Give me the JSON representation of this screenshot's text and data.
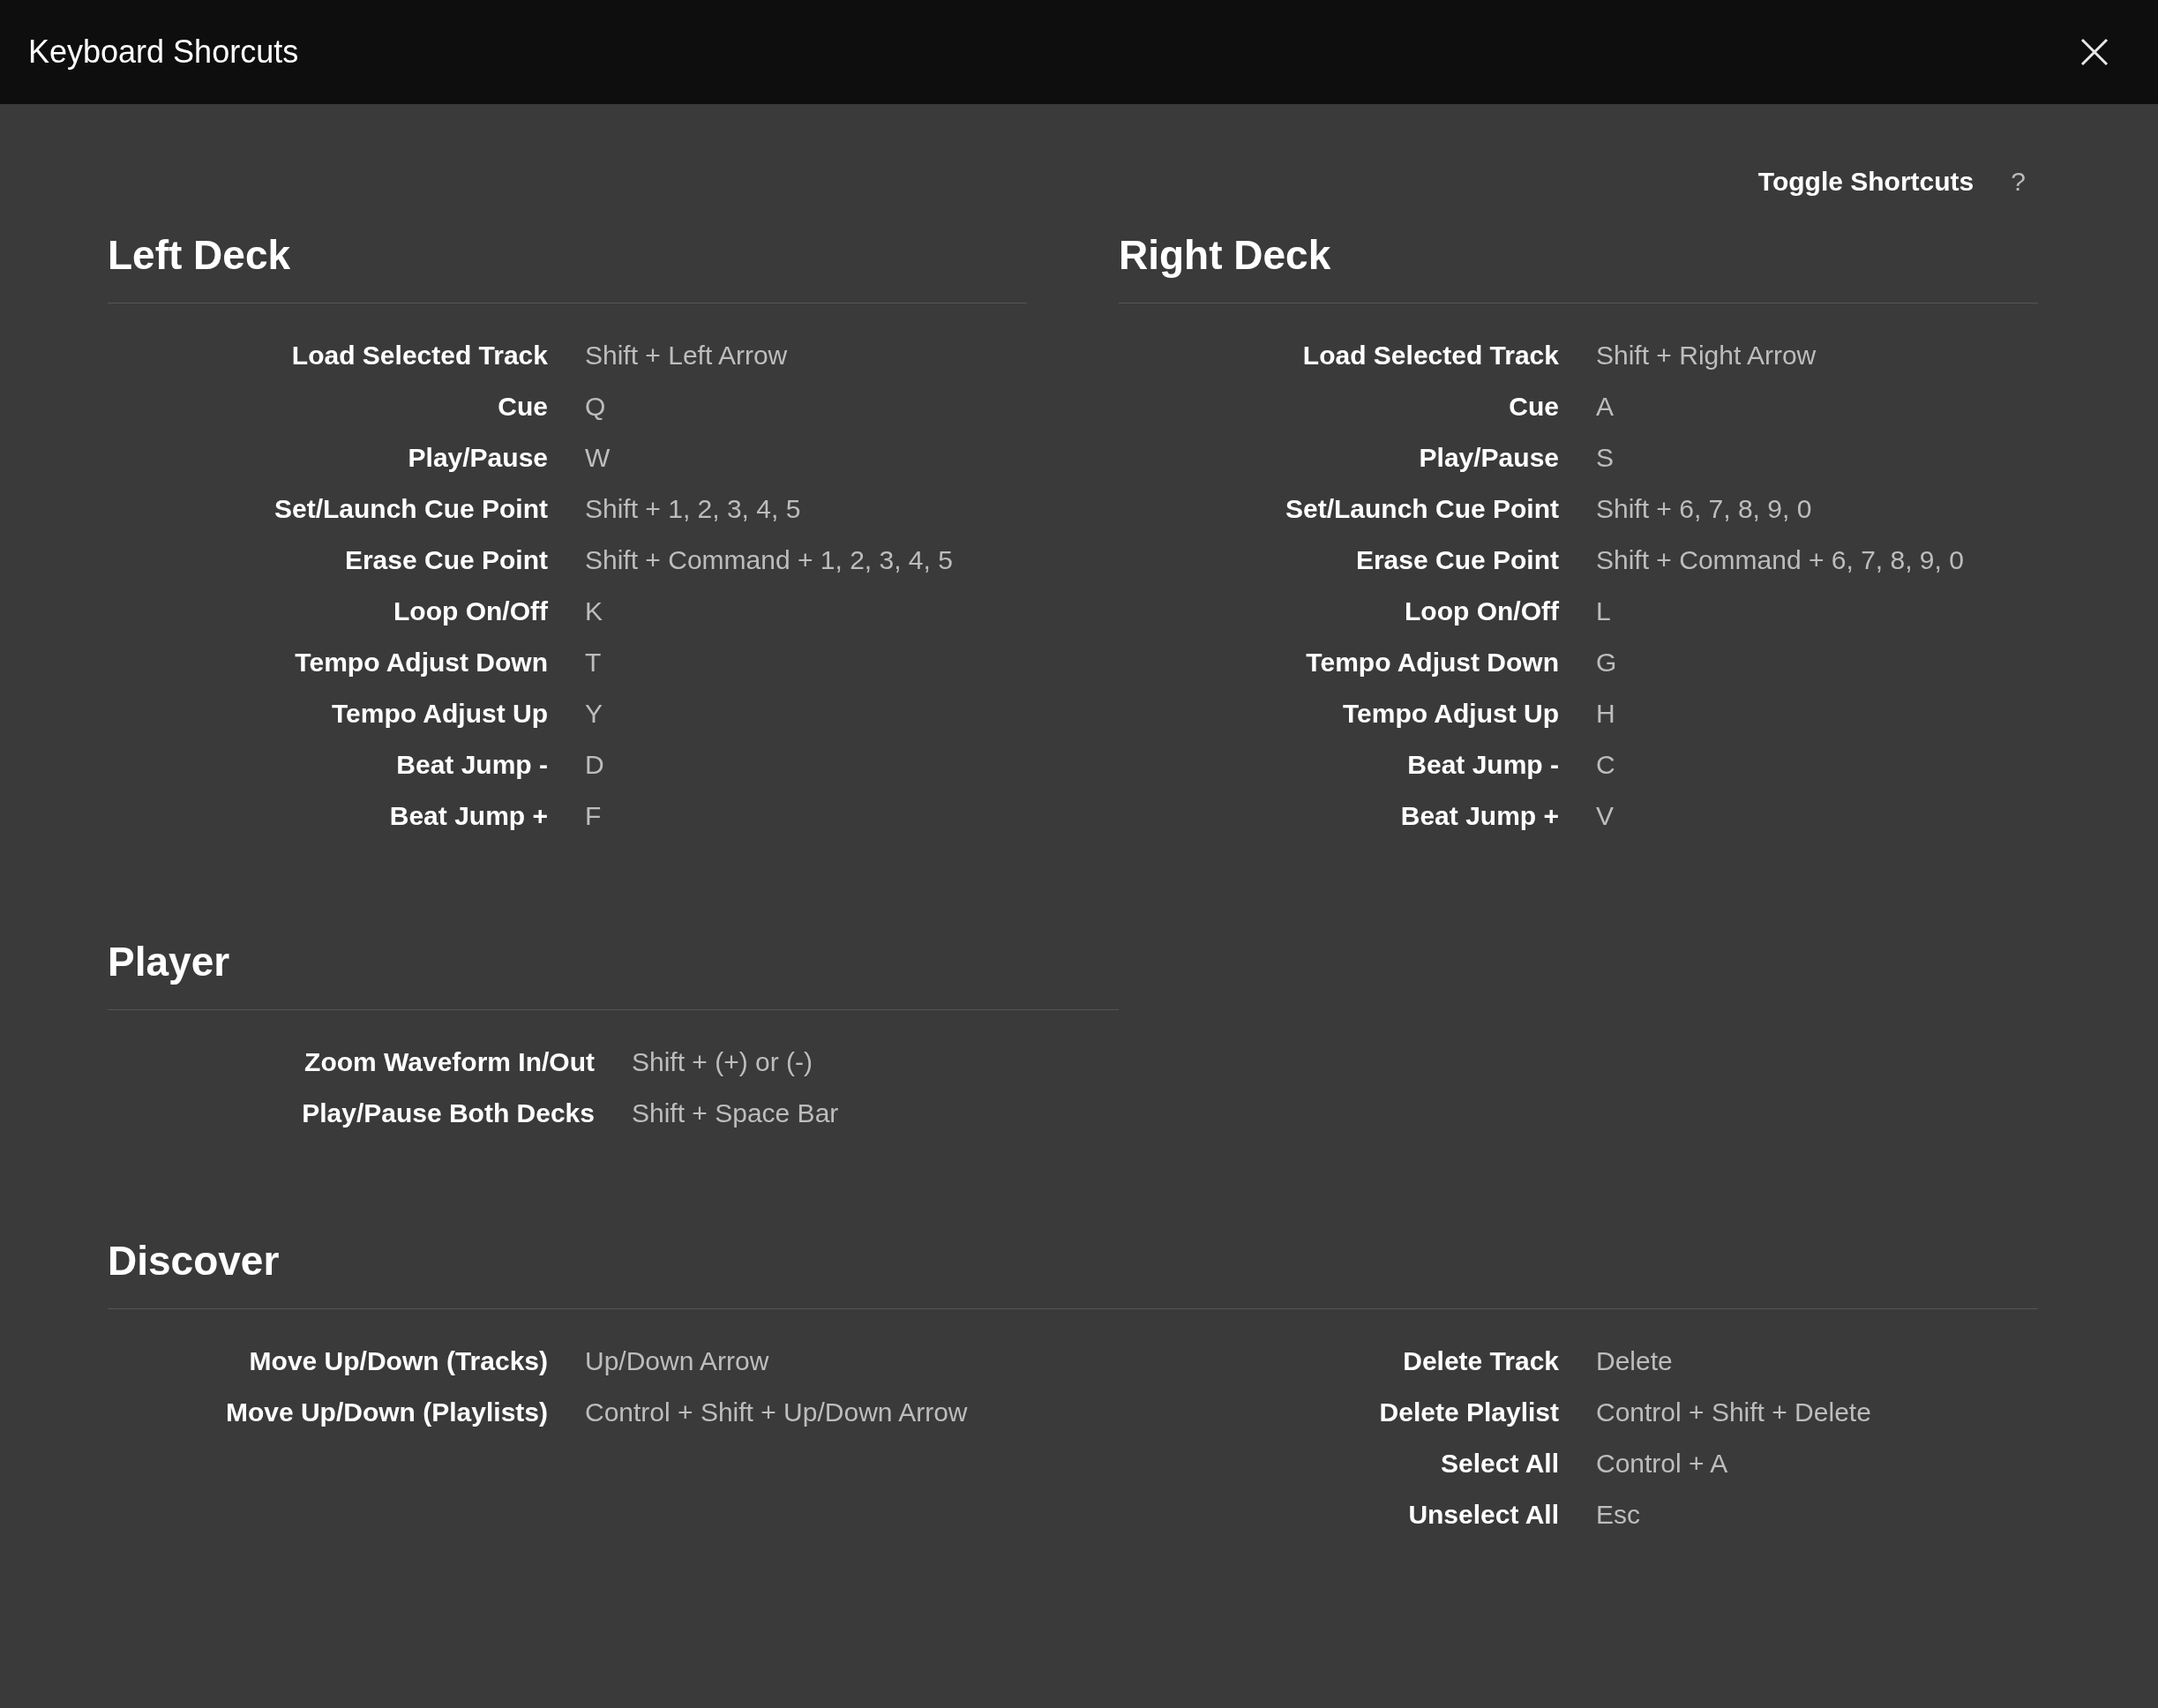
{
  "window": {
    "title": "Keyboard Shorcuts"
  },
  "toggle": {
    "label": "Toggle Shortcuts",
    "key": "?"
  },
  "decks": [
    {
      "heading": "Left Deck",
      "shortcuts": [
        {
          "action": "Load Selected Track",
          "keys": "Shift + Left Arrow"
        },
        {
          "action": "Cue",
          "keys": "Q"
        },
        {
          "action": "Play/Pause",
          "keys": "W"
        },
        {
          "action": "Set/Launch Cue Point",
          "keys": "Shift + 1, 2, 3, 4, 5"
        },
        {
          "action": "Erase Cue Point",
          "keys": "Shift + Command + 1, 2, 3, 4, 5"
        },
        {
          "action": "Loop On/Off",
          "keys": "K"
        },
        {
          "action": "Tempo Adjust Down",
          "keys": "T"
        },
        {
          "action": "Tempo Adjust Up",
          "keys": "Y"
        },
        {
          "action": "Beat Jump -",
          "keys": "D"
        },
        {
          "action": "Beat Jump +",
          "keys": "F"
        }
      ]
    },
    {
      "heading": "Right Deck",
      "shortcuts": [
        {
          "action": "Load Selected Track",
          "keys": "Shift + Right Arrow"
        },
        {
          "action": "Cue",
          "keys": "A"
        },
        {
          "action": "Play/Pause",
          "keys": "S"
        },
        {
          "action": "Set/Launch Cue Point",
          "keys": "Shift + 6, 7, 8, 9, 0"
        },
        {
          "action": "Erase Cue Point",
          "keys": "Shift + Command + 6, 7, 8, 9, 0"
        },
        {
          "action": "Loop On/Off",
          "keys": "L"
        },
        {
          "action": "Tempo Adjust Down",
          "keys": "G"
        },
        {
          "action": "Tempo Adjust Up",
          "keys": "H"
        },
        {
          "action": "Beat Jump -",
          "keys": "C"
        },
        {
          "action": "Beat Jump +",
          "keys": "V"
        }
      ]
    }
  ],
  "player": {
    "heading": "Player",
    "shortcuts": [
      {
        "action": "Zoom Waveform In/Out",
        "keys": "Shift + (+) or (-)"
      },
      {
        "action": "Play/Pause Both Decks",
        "keys": "Shift + Space Bar"
      }
    ]
  },
  "discover": {
    "heading": "Discover",
    "columns": [
      [
        {
          "action": "Move Up/Down (Tracks)",
          "keys": "Up/Down Arrow"
        },
        {
          "action": "Move Up/Down (Playlists)",
          "keys": "Control + Shift + Up/Down Arrow"
        }
      ],
      [
        {
          "action": "Delete Track",
          "keys": "Delete"
        },
        {
          "action": "Delete Playlist",
          "keys": "Control + Shift + Delete"
        },
        {
          "action": "Select All",
          "keys": "Control + A"
        },
        {
          "action": "Unselect All",
          "keys": "Esc"
        }
      ]
    ]
  }
}
